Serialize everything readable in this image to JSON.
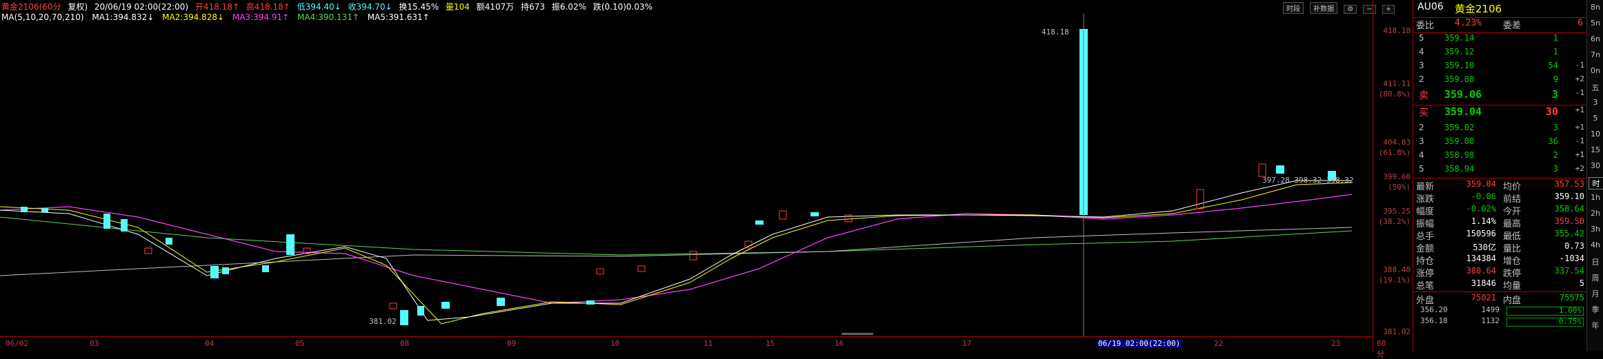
{
  "header": {
    "title": "黄金2106(60分",
    "adj": "复权)",
    "datetime": "20/06/19 02:00(22:00)",
    "open": "开418.18↑",
    "high": "高418.18↑",
    "low": "低394.40↓",
    "close": "收394.70↓",
    "turnover": "换15.45%",
    "vol": "量104",
    "amount": "额4107万",
    "hold": "持673",
    "amp": "振6.02%",
    "chg": "跌(0.10)0.03%"
  },
  "ma": {
    "params": "MA(5,10,20,70,210)",
    "ma1": "MA1:394.832↓",
    "ma2": "MA2:394.828↓",
    "ma3": "MA3:394.91↑",
    "ma4": "MA4:390.131↑",
    "ma5": "MA5:391.631↑"
  },
  "tools": {
    "period": "时段",
    "review": "补数据"
  },
  "price_axis": [
    "418.18",
    "411.11",
    "(80.8%)",
    "404.03",
    "(61.8%)",
    "399.60",
    "(50%)",
    "395.25",
    "(38.2%)",
    "388.40",
    "(19.1%)",
    "381.02"
  ],
  "annotations": {
    "hi_label": "418.18",
    "lo_label": "381.02",
    "right_label": "397.28 398.32 398.32"
  },
  "date_axis": [
    "06/02",
    "03",
    "04",
    "05",
    "08",
    "09",
    "10",
    "11",
    "15",
    "16",
    "17",
    "18",
    "06/19 02:00(22:00)",
    "22",
    "23",
    "60分"
  ],
  "quote": {
    "code": "AU06",
    "name": "黄金2106",
    "weibi_label": "委比",
    "weibi": "4.23%",
    "weicha_label": "委差",
    "weicha": "6",
    "asks": [
      {
        "lvl": "5",
        "price": "359.14",
        "vol": "1",
        "chg": ""
      },
      {
        "lvl": "4",
        "price": "359.12",
        "vol": "1",
        "chg": ""
      },
      {
        "lvl": "3",
        "price": "359.10",
        "vol": "54",
        "chg": "-1"
      },
      {
        "lvl": "2",
        "price": "359.08",
        "vol": "9",
        "chg": "+2"
      }
    ],
    "sell1": {
      "lvl": "卖",
      "price": "359.06",
      "vol": "3",
      "chg": "-1"
    },
    "buy1": {
      "lvl": "买",
      "price": "359.04",
      "vol": "30",
      "chg": "+1"
    },
    "bids": [
      {
        "lvl": "2",
        "price": "359.02",
        "vol": "3",
        "chg": "+1"
      },
      {
        "lvl": "3",
        "price": "359.00",
        "vol": "36",
        "chg": "-1"
      },
      {
        "lvl": "4",
        "price": "358.98",
        "vol": "2",
        "chg": "+1"
      },
      {
        "lvl": "5",
        "price": "358.94",
        "vol": "3",
        "chg": "+2"
      }
    ],
    "stats": [
      {
        "l1": "最新",
        "v1": "359.04",
        "c1": "red",
        "l2": "均价",
        "v2": "357.53",
        "c2": "red"
      },
      {
        "l1": "涨跌",
        "v1": "-0.06",
        "c1": "green",
        "l2": "前结",
        "v2": "359.10",
        "c2": "white"
      },
      {
        "l1": "幅度",
        "v1": "-0.02%",
        "c1": "green",
        "l2": "今开",
        "v2": "358.64",
        "c2": "green"
      },
      {
        "l1": "振幅",
        "v1": "1.14%",
        "c1": "white",
        "l2": "最高",
        "v2": "359.50",
        "c2": "red"
      },
      {
        "l1": "总手",
        "v1": "150596",
        "c1": "white",
        "l2": "最低",
        "v2": "355.42",
        "c2": "green"
      },
      {
        "l1": "金额",
        "v1": "530亿",
        "c1": "white",
        "l2": "量比",
        "v2": "0.73",
        "c2": "white"
      },
      {
        "l1": "持仓",
        "v1": "134384",
        "c1": "white",
        "l2": "增仓",
        "v2": "-1034",
        "c2": "white"
      },
      {
        "l1": "涨停",
        "v1": "380.64",
        "c1": "red",
        "l2": "跌停",
        "v2": "337.54",
        "c2": "green"
      },
      {
        "l1": "总笔",
        "v1": "31846",
        "c1": "white",
        "l2": "均量",
        "v2": "5",
        "c2": "white"
      }
    ],
    "outer_label": "外盘",
    "outer": "75021",
    "inner_label": "内盘",
    "inner": "75575",
    "ticks": [
      {
        "price": "356.20",
        "vol": "1499",
        "pct": "1.00%"
      },
      {
        "price": "356.18",
        "vol": "1132",
        "pct": "0.75%"
      }
    ]
  },
  "side_tabs": [
    "8n",
    "5n",
    "6n",
    "7n",
    "0n",
    "五",
    "3",
    "5",
    "10",
    "15",
    "30",
    "时",
    "1h",
    "2h",
    "3h",
    "4h",
    "日",
    "周",
    "月",
    "季",
    "年"
  ],
  "colors": {
    "up": "#ff4040",
    "down": "#54fcfc",
    "ma1": "#ffffff",
    "ma2": "#ffff00",
    "ma3": "#ff40ff",
    "ma4": "#5cd65c",
    "ma5": "#c0c0c0",
    "axis": "#b00000"
  }
}
